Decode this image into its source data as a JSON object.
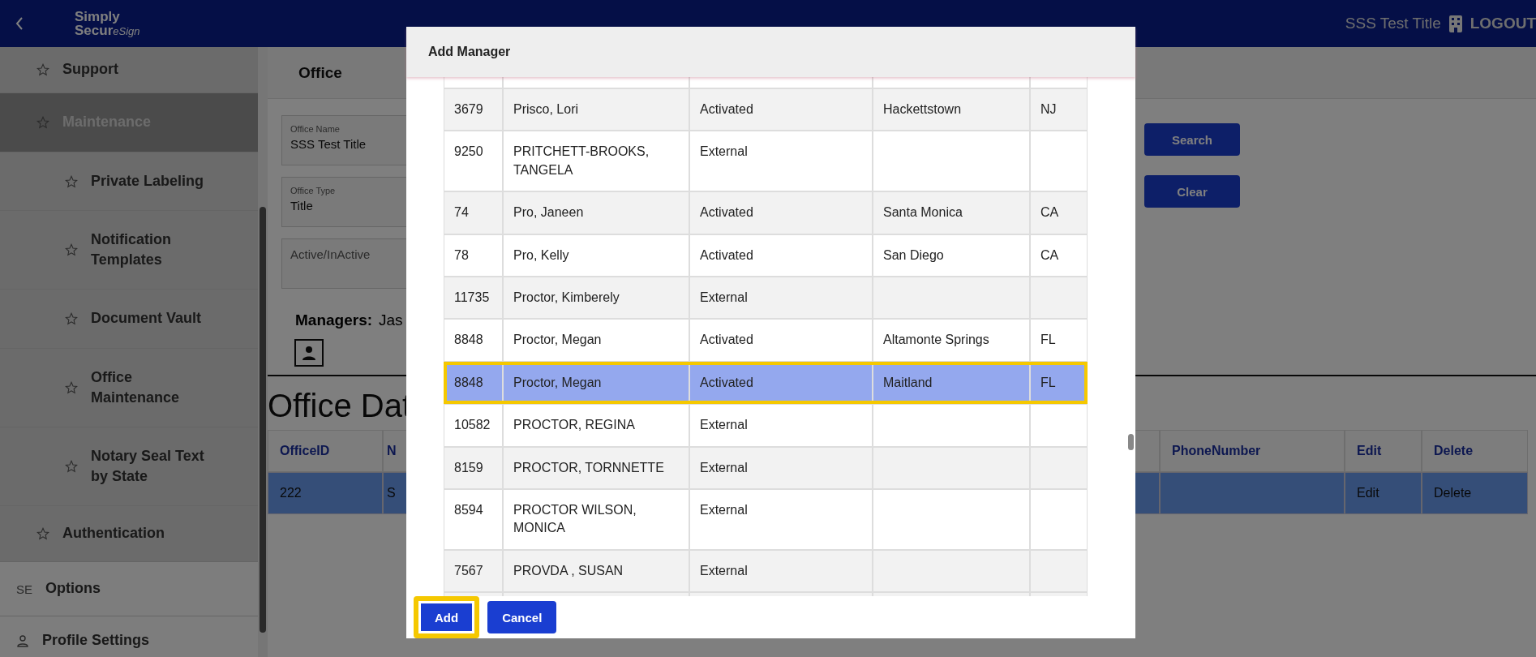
{
  "header": {
    "logo": {
      "line_1": "Simply",
      "line_2": "Secur",
      "line_3": "eSign"
    },
    "office_title": "SSS Test Title",
    "logout": "LOGOUT"
  },
  "sidebar": {
    "nested_items": [
      {
        "label": "Support",
        "selected": false
      },
      {
        "label": "Maintenance",
        "selected": true,
        "children": [
          {
            "label": "Private Labeling",
            "selected": false
          },
          {
            "label": "Notification Templates",
            "selected": false
          },
          {
            "label": "Document Vault",
            "selected": false
          },
          {
            "label": "Office Maintenance",
            "selected": false
          },
          {
            "label": "Notary Seal Text by State",
            "selected": false
          }
        ]
      },
      {
        "label": "Authentication",
        "selected": false
      }
    ],
    "items": [
      {
        "label": "Options",
        "icon_text": "SE",
        "selected": false
      },
      {
        "label": "Profile Settings",
        "selected": false
      }
    ]
  },
  "office_tab": "Office",
  "form": {
    "fields": [
      {
        "label": "Office Name",
        "value": "SSS Test Title"
      },
      {
        "label": "Office Type",
        "value": "Title"
      },
      {
        "placeholder": "Active/InActive"
      }
    ],
    "buttons": [
      "Search",
      "Clear"
    ]
  },
  "managers": {
    "label": "Managers:",
    "value": "Jas"
  },
  "office_data": {
    "title": "Office Dat",
    "columns": [
      "OfficeID",
      "N",
      "PhoneNumber",
      "Edit",
      "Delete"
    ],
    "rows": [
      {
        "cells": [
          "222",
          "S",
          "",
          "Edit",
          "Delete"
        ],
        "selected": true
      }
    ]
  },
  "dialog": {
    "title": "Add Manager",
    "rows": [
      {
        "id": "3679",
        "name": "Prisco, Lori",
        "status": "Activated",
        "city": "Hackettstown",
        "state": "NJ",
        "selected": false
      },
      {
        "id": "9250",
        "name": "PRITCHETT-BROOKS, TANGELA",
        "status": "External",
        "city": "",
        "state": "",
        "selected": false
      },
      {
        "id": "74",
        "name": "Pro, Janeen",
        "status": "Activated",
        "city": "Santa Monica",
        "state": "CA",
        "selected": false
      },
      {
        "id": "78",
        "name": "Pro, Kelly",
        "status": "Activated",
        "city": "San Diego",
        "state": "CA",
        "selected": false
      },
      {
        "id": "11735",
        "name": "Proctor, Kimberely",
        "status": "External",
        "city": "",
        "state": "",
        "selected": false
      },
      {
        "id": "8848",
        "name": "Proctor, Megan",
        "status": "Activated",
        "city": "Altamonte Springs",
        "state": "FL",
        "selected": false
      },
      {
        "id": "8848",
        "name": "Proctor, Megan",
        "status": "Activated",
        "city": "Maitland",
        "state": "FL",
        "selected": true
      },
      {
        "id": "10582",
        "name": "PROCTOR, REGINA",
        "status": "External",
        "city": "",
        "state": "",
        "selected": false
      },
      {
        "id": "8159",
        "name": "PROCTOR, TORNNETTE",
        "status": "External",
        "city": "",
        "state": "",
        "selected": false
      },
      {
        "id": "8594",
        "name": "PROCTOR WILSON, MONICA",
        "status": "External",
        "city": "",
        "state": "",
        "selected": false
      },
      {
        "id": "7567",
        "name": "PROVDA , SUSAN",
        "status": "External",
        "city": "",
        "state": "",
        "selected": false
      }
    ],
    "buttons": [
      {
        "label": "Add",
        "highlighted": true
      },
      {
        "label": "Cancel",
        "highlighted": false
      }
    ]
  }
}
